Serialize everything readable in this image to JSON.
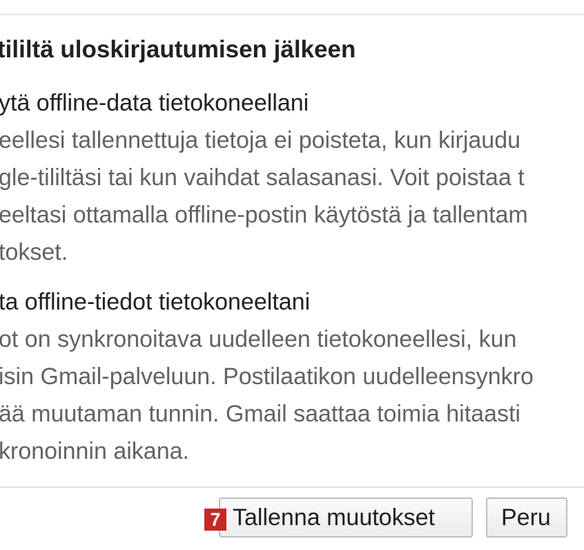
{
  "settings": {
    "heading": "tililtä uloskirjautumisen jälkeen",
    "options": [
      {
        "title": "ytä offline-data tietokoneellani",
        "description_lines": [
          "eellesi tallennettuja tietoja ei poisteta, kun kirjaudu",
          "gle-tililtäsi tai kun vaihdat salasanasi. Voit poistaa t",
          "eeltasi ottamalla offline-postin käytöstä ja tallentam",
          "tokset."
        ]
      },
      {
        "title": "ta offline-tiedot tietokoneeltani",
        "description_lines": [
          "ot on synkronoitava uudelleen tietokoneellesi, kun",
          "isin Gmail-palveluun. Postilaatikon uudelleensynkro",
          "ää muutaman tunnin. Gmail saattaa toimia hitaasti",
          "kronoinnin aikana."
        ]
      }
    ]
  },
  "footer": {
    "step_badge": "7",
    "save_label": "Tallenna muutokset",
    "cancel_label": "Peru"
  },
  "colors": {
    "badge": "#c62828",
    "text_primary": "#202124",
    "text_secondary": "#5f6368"
  }
}
